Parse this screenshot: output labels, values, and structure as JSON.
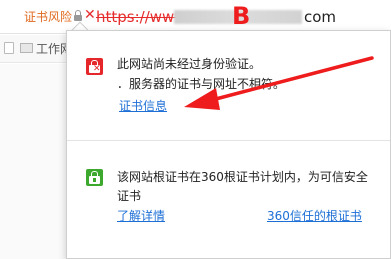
{
  "address_bar": {
    "cert_warning": "证书风险",
    "url_prefix": "https://www.",
    "url_suffix": "com",
    "annotation_letter": "B"
  },
  "bookmarks_bar": {
    "folder_label": "工作网"
  },
  "popup": {
    "warning": {
      "line1": "此网站尚未经过身份验证。",
      "line2": "．服务器的证书与网址不相符。",
      "link": "证书信息"
    },
    "trust": {
      "text": "该网站根证书在360根证书计划内，为可信安全证书",
      "link_more": "了解详情",
      "link_trusted": "360信任的根证书"
    }
  },
  "colors": {
    "warning_text": "#e06a1f",
    "danger_red": "#e5262a",
    "link_blue": "#1d6fd6",
    "safe_green": "#3da82e",
    "annotation_red": "#ee1c1c"
  }
}
